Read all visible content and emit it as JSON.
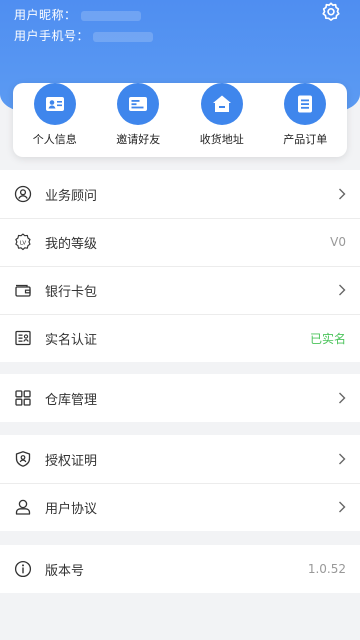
{
  "header": {
    "nickname_label": "用户昵称：",
    "phone_label": "用户手机号：",
    "bg_color": "#5294f2"
  },
  "quick_actions": [
    {
      "label": "个人信息",
      "icon": "profile-card-icon"
    },
    {
      "label": "邀请好友",
      "icon": "invite-card-icon"
    },
    {
      "label": "收货地址",
      "icon": "home-address-icon"
    },
    {
      "label": "产品订单",
      "icon": "order-list-icon"
    }
  ],
  "menu": {
    "advisor": {
      "label": "业务顾问",
      "icon": "advisor-icon"
    },
    "level": {
      "label": "我的等级",
      "value": "V0",
      "icon": "level-badge-icon"
    },
    "bank_card": {
      "label": "银行卡包",
      "icon": "wallet-icon"
    },
    "real_name": {
      "label": "实名认证",
      "value": "已实名",
      "value_color": "#4bc35b",
      "icon": "id-card-icon"
    },
    "warehouse": {
      "label": "仓库管理",
      "icon": "grid-icon"
    },
    "authorization": {
      "label": "授权证明",
      "icon": "shield-user-icon"
    },
    "agreement": {
      "label": "用户协议",
      "icon": "user-icon"
    },
    "version": {
      "label": "版本号",
      "value": "1.0.52",
      "icon": "info-icon"
    }
  }
}
